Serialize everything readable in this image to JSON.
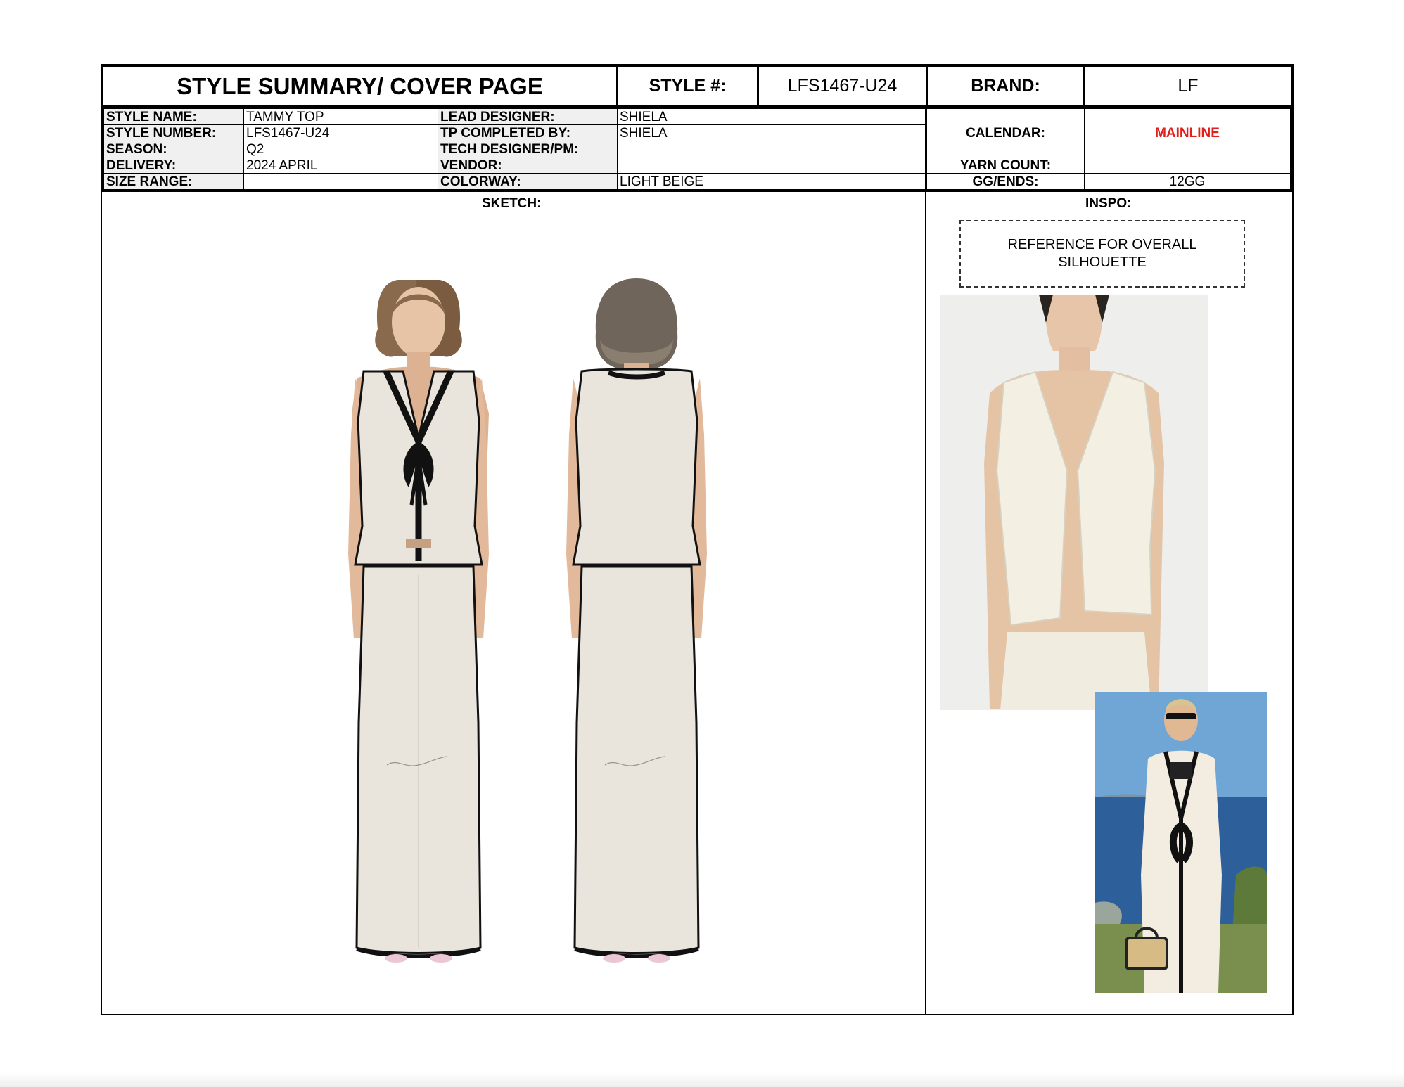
{
  "header": {
    "title": "STYLE SUMMARY/ COVER PAGE",
    "style_no_label": "STYLE #:",
    "style_no_value": "LFS1467-U24",
    "brand_label": "BRAND:",
    "brand_value": "LF"
  },
  "info": {
    "style_name_label": "STYLE NAME:",
    "style_name": "TAMMY TOP",
    "style_number_label": "STYLE NUMBER:",
    "style_number": " LFS1467-U24",
    "season_label": "SEASON:",
    "season": "Q2",
    "delivery_label": "DELIVERY:",
    "delivery": "2024 APRIL",
    "size_range_label": "SIZE RANGE:",
    "size_range": "",
    "lead_designer_label": "LEAD DESIGNER:",
    "lead_designer": "SHIELA",
    "tp_completed_label": "TP COMPLETED BY:",
    "tp_completed": "SHIELA",
    "tech_designer_label": "TECH DESIGNER/PM:",
    "tech_designer": "",
    "vendor_label": "VENDOR:",
    "vendor": "",
    "colorway_label": "COLORWAY:",
    "colorway": "LIGHT BEIGE",
    "calendar_label": "CALENDAR:",
    "calendar": "MAINLINE",
    "yarn_count_label": "YARN COUNT:",
    "yarn_count": "",
    "gg_ends_label": "GG/ENDS:",
    "gg_ends": "12GG"
  },
  "sections": {
    "sketch_label": "SKETCH:",
    "inspo_label": "INSPO:",
    "inspo_note": "REFERENCE FOR OVERALL SILHOUETTE"
  },
  "colors": {
    "garment": "#e9e5dc",
    "trim": "#111111",
    "accent_red": "#e0201c",
    "photo_bg": "#eeeeec",
    "sea": "#2d5f9a",
    "sky": "#6fa6d6"
  }
}
